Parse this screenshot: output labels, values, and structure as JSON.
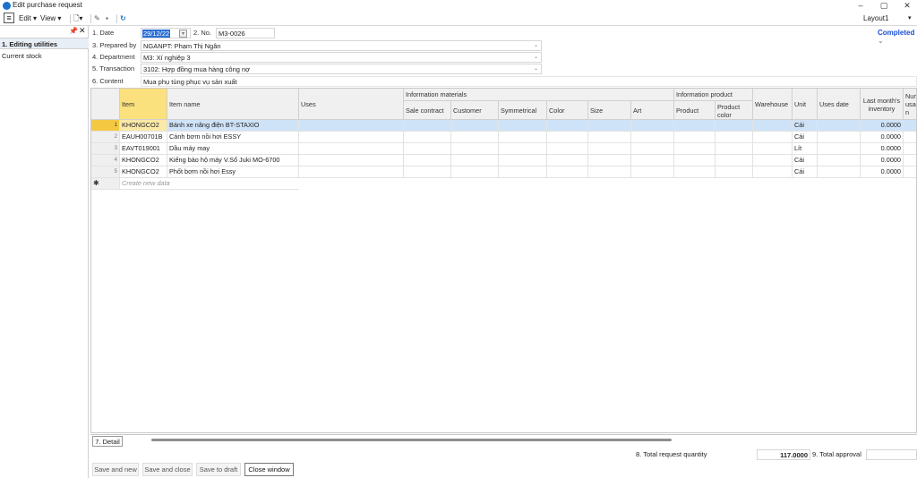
{
  "window": {
    "title": "Edit purchase request",
    "minimize": "–",
    "restore": "▢",
    "close": "✕"
  },
  "toolbar": {
    "edit": "Edit ▾",
    "view": "View ▾",
    "layout": "Layout1"
  },
  "status": "Completed",
  "sidepanel": {
    "items": [
      "1. Editing utilities",
      "Current stock"
    ]
  },
  "form": {
    "date_label": "1. Date",
    "date_value": "29/12/22",
    "no_label": "2. No.",
    "no_value": "M3-0026",
    "prepared_label": "3. Prepared by",
    "prepared_value": "NGANPT: Phạm Thị Ngân",
    "department_label": "4. Department",
    "department_value": "M3: Xí nghiệp 3",
    "transaction_label": "5. Transaction",
    "transaction_value": "3102: Hợp đồng mua hàng công nợ",
    "content_label": "6. Content",
    "content_value": "Mua phụ tùng phục vụ sản xuất"
  },
  "grid": {
    "group_headers": {
      "materials": "Information materials",
      "product": "Information product"
    },
    "columns": {
      "item": "Item",
      "item_name": "Item name",
      "uses": "Uses",
      "sale_contract": "Sale contract",
      "customer": "Customer",
      "symmetrical": "Symmetrical",
      "color": "Color",
      "size": "Size",
      "art": "Art",
      "product": "Product",
      "product_color": "Product color",
      "warehouse": "Warehouse",
      "unit": "Unit",
      "uses_date": "Uses date",
      "last_inventory": "Last month's inventory",
      "num_usage": "Num usa n"
    },
    "rows": [
      {
        "n": "1",
        "item": "KHONGCO2",
        "name": "Bánh xe nâng điện BT-STAXIO",
        "unit": "Cái",
        "inv": "0.0000"
      },
      {
        "n": "2",
        "item": "EAUH00701B",
        "name": "Cánh bơm nồi hơi ESSY",
        "unit": "Cái",
        "inv": "0.0000"
      },
      {
        "n": "3",
        "item": "EAVT019001",
        "name": "Dầu máy may",
        "unit": "Lít",
        "inv": "0.0000"
      },
      {
        "n": "4",
        "item": "KHONGCO2",
        "name": "Kiếng bảo hộ máy V.Sổ Juki MO-6700",
        "unit": "Cái",
        "inv": "0.0000"
      },
      {
        "n": "5",
        "item": "KHONGCO2",
        "name": "Phốt bơm nồi hơi Essy",
        "unit": "Cái",
        "inv": "0.0000"
      }
    ],
    "new_row": "Create new data"
  },
  "bottom": {
    "tab": "7. Detail",
    "total_label": "8. Total request quantity",
    "total_value": "117.0000",
    "approval_label": "9. Total approval"
  },
  "buttons": {
    "save_new": "Save and new",
    "save_close": "Save and close",
    "save_draft": "Save to draft",
    "close": "Close window"
  }
}
